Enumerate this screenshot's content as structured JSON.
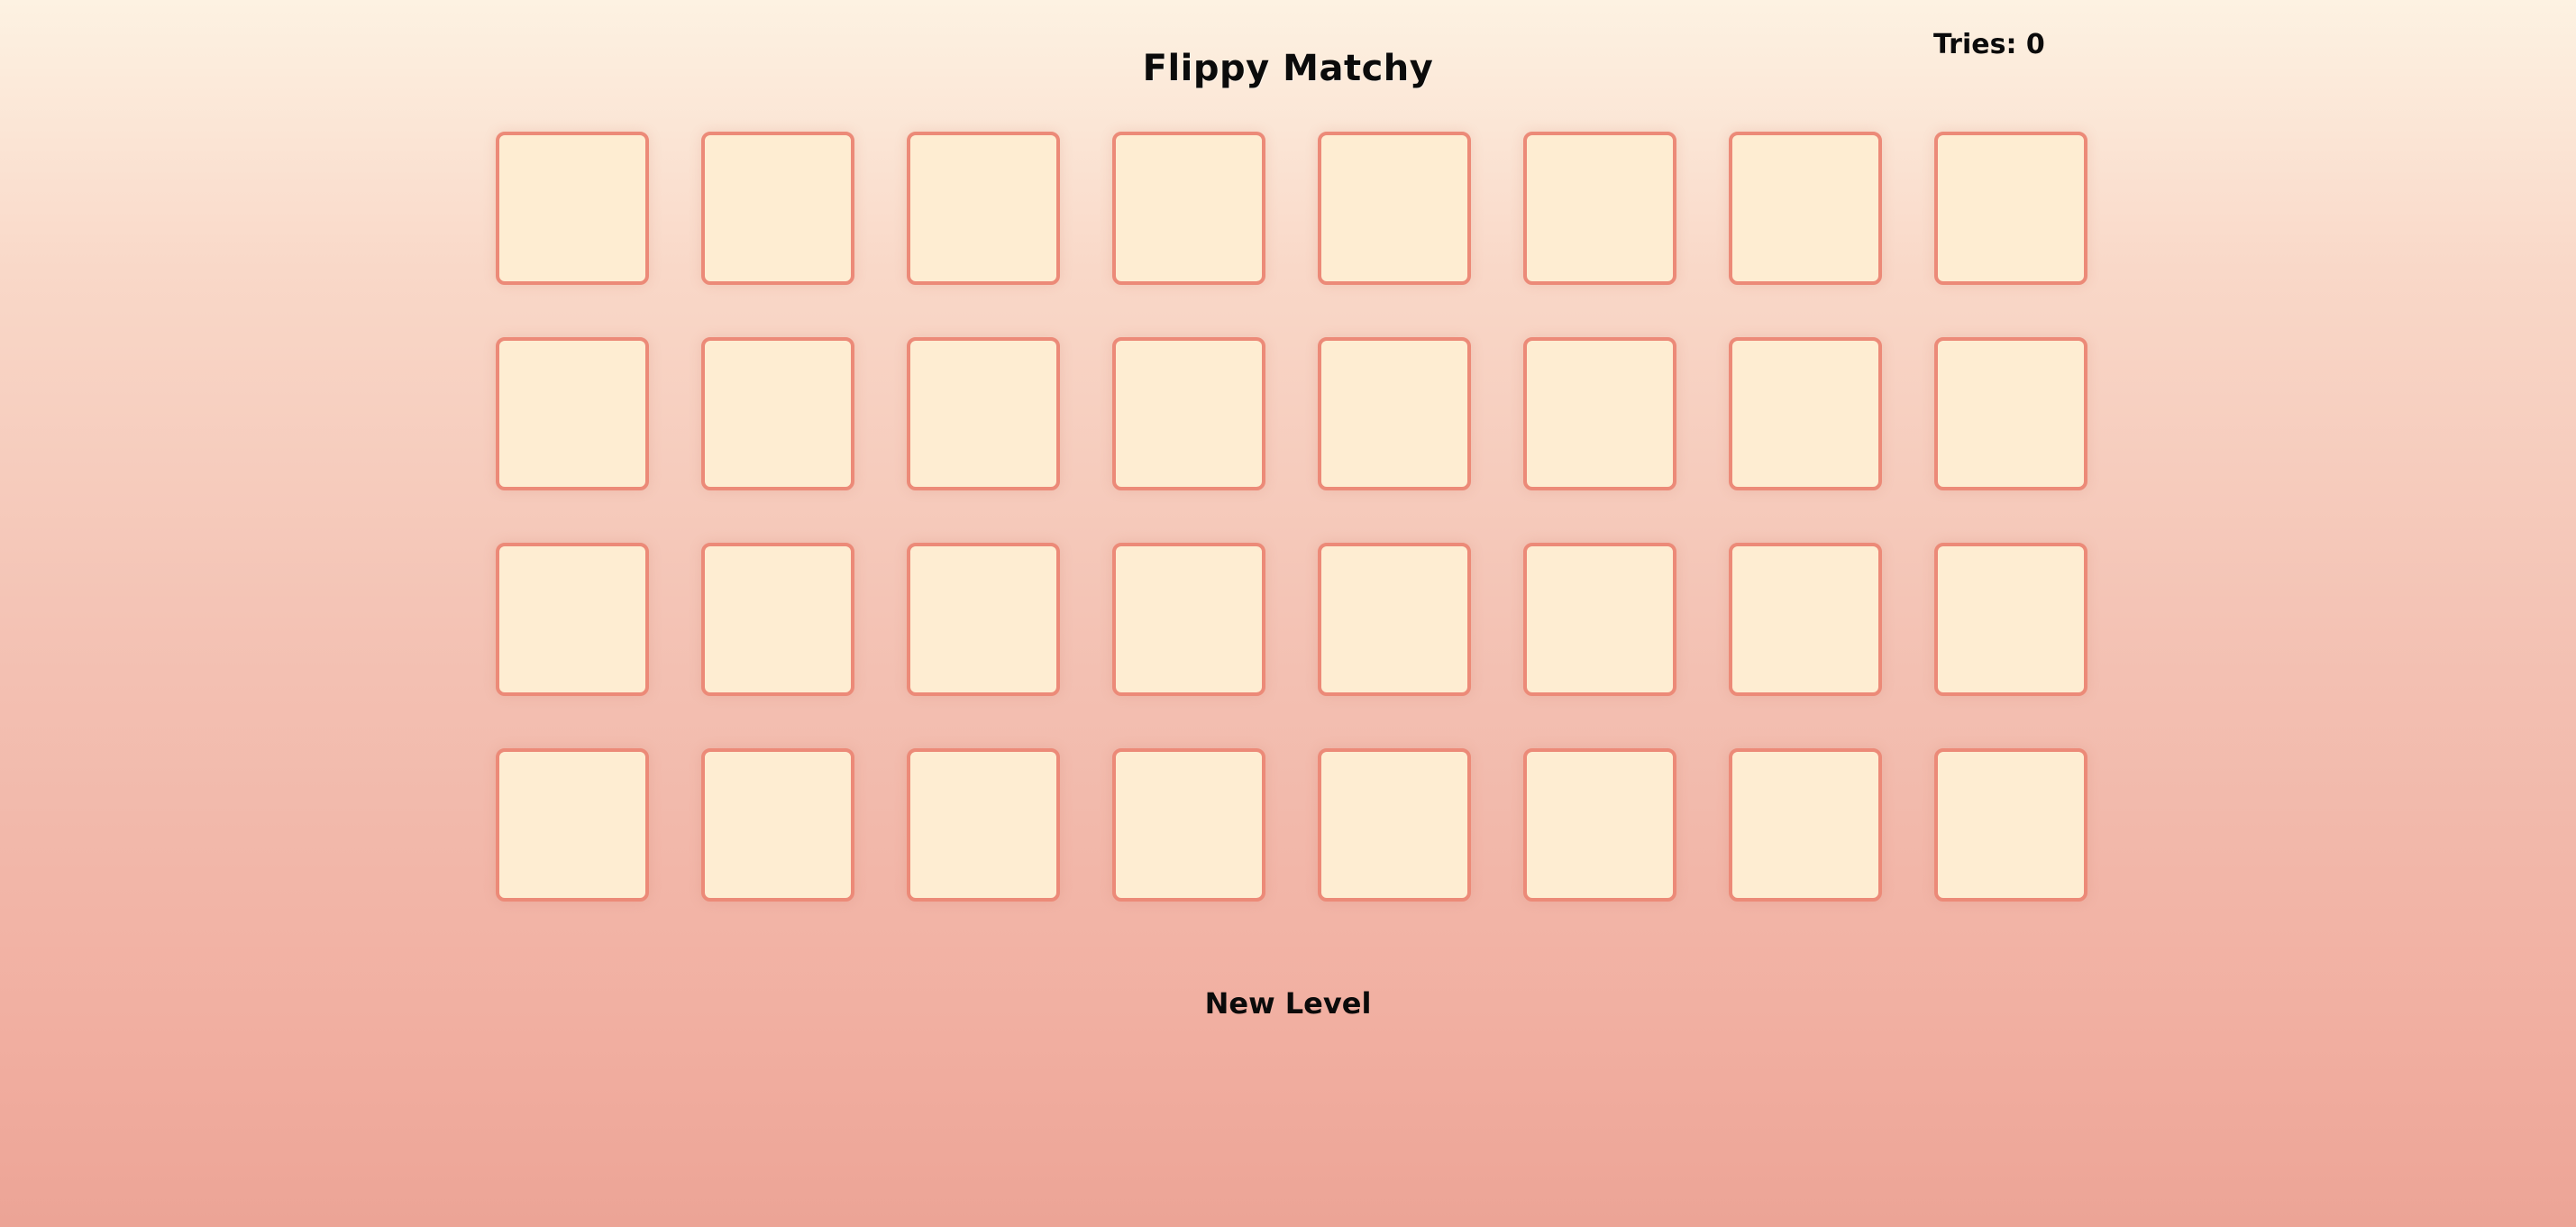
{
  "header": {
    "title": "Flippy Matchy",
    "tries_label": "Tries: 0"
  },
  "board": {
    "rows": 4,
    "columns": 8,
    "cards_face_down": 32
  },
  "actions": {
    "new_level_label": "New Level"
  },
  "colors": {
    "card_face": "#feedd2",
    "card_border": "#ec8a78",
    "background_top": "#fdf2e2",
    "background_bottom": "#eca496"
  }
}
